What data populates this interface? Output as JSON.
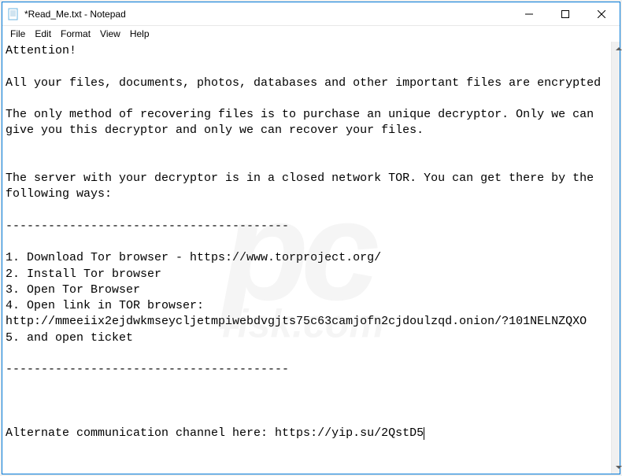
{
  "window": {
    "title": "*Read_Me.txt - Notepad"
  },
  "menu": {
    "file": "File",
    "edit": "Edit",
    "format": "Format",
    "view": "View",
    "help": "Help"
  },
  "document": {
    "line1": "Attention!",
    "line2": "",
    "line3": "All your files, documents, photos, databases and other important files are encrypted",
    "line4": "",
    "line5": "The only method of recovering files is to purchase an unique decryptor. Only we can give you this decryptor and only we can recover your files.",
    "line6": "",
    "line7": "",
    "line8": "The server with your decryptor is in a closed network TOR. You can get there by the following ways:",
    "line9": "",
    "line10": "----------------------------------------",
    "line11": "",
    "line12": "1. Download Tor browser - https://www.torproject.org/",
    "line13": "2. Install Tor browser",
    "line14": "3. Open Tor Browser",
    "line15": "4. Open link in TOR browser: http://mmeeiix2ejdwkmseycljetmpiwebdvgjts75c63camjofn2cjdoulzqd.onion/?101NELNZQXO",
    "line16": "5. and open ticket",
    "line17": "",
    "line18": "----------------------------------------",
    "line19": "",
    "line20": "",
    "line21": "",
    "line22": "Alternate communication channel here: https://yip.su/2QstD5"
  },
  "watermark": {
    "main": "pc",
    "sub": "risk.com"
  }
}
